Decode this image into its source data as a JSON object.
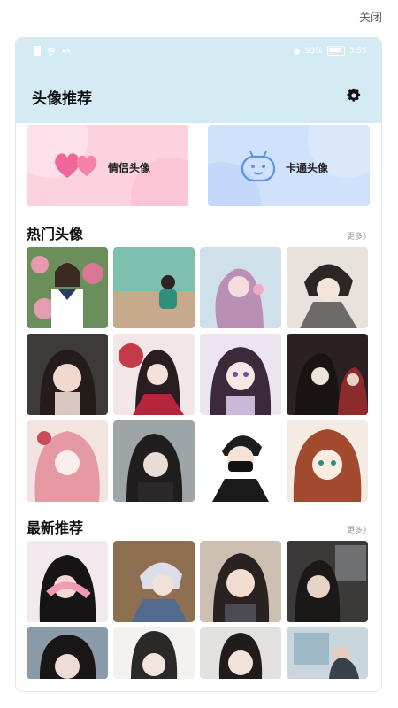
{
  "topbar": {
    "close_label": "关闭"
  },
  "statusbar": {
    "battery_text": "93%",
    "time": "3:55"
  },
  "app": {
    "title": "头像推荐"
  },
  "cards": [
    {
      "label": "情侣头像",
      "color": "#fcd2df",
      "icon": "hearts-icon"
    },
    {
      "label": "卡通头像",
      "color": "#cfe1fb",
      "icon": "cartoon-robot-icon"
    }
  ],
  "sections": {
    "hot": {
      "title": "热门头像",
      "more": "更多》"
    },
    "latest": {
      "title": "最新推荐",
      "more": "更多》"
    }
  },
  "colors": {
    "header_bg": "#d4ebf4",
    "card_pink": "#fcd2df",
    "card_blue": "#cfe1fb",
    "heart": "#f0669a",
    "robot": "#5a95e8"
  }
}
